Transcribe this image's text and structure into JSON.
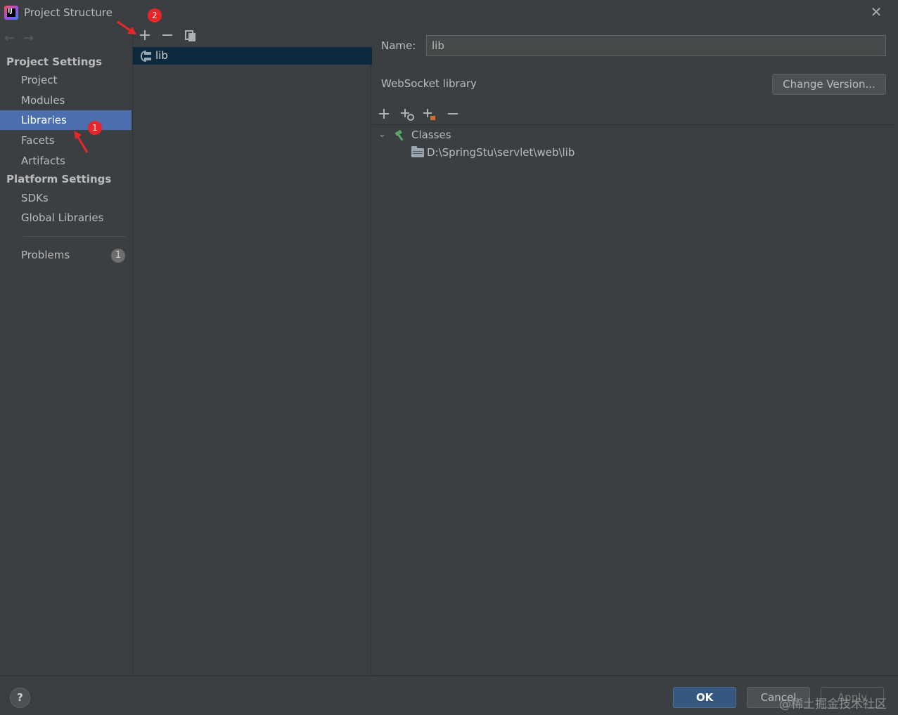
{
  "window": {
    "title": "Project Structure",
    "close_symbol": "✕"
  },
  "sidebar": {
    "nav_back": "←",
    "nav_forward": "→",
    "project_settings_header": "Project Settings",
    "project_settings_items": [
      {
        "label": "Project",
        "selected": false
      },
      {
        "label": "Modules",
        "selected": false
      },
      {
        "label": "Libraries",
        "selected": true
      },
      {
        "label": "Facets",
        "selected": false
      },
      {
        "label": "Artifacts",
        "selected": false
      }
    ],
    "platform_settings_header": "Platform Settings",
    "platform_settings_items": [
      {
        "label": "SDKs"
      },
      {
        "label": "Global Libraries"
      }
    ],
    "problems_label": "Problems",
    "problems_count": "1"
  },
  "libraries_panel": {
    "toolbar": {
      "add_icon": "plus-icon",
      "remove_icon": "minus-icon",
      "copy_icon": "copy-icon"
    },
    "items": [
      {
        "label": "lib",
        "selected": true
      }
    ]
  },
  "library_details": {
    "name_label": "Name:",
    "name_value": "lib",
    "library_type": "WebSocket library",
    "change_version_label": "Change Version...",
    "toolbar_icons": [
      "add-icon",
      "add-jar-icon",
      "add-source-icon",
      "remove-icon"
    ],
    "tree": {
      "root_label": "Classes",
      "children": [
        "D:\\SpringStu\\servlet\\web\\lib"
      ]
    }
  },
  "footer": {
    "help_label": "?",
    "ok_label": "OK",
    "cancel_label": "Cancel",
    "apply_label": "Apply",
    "watermark": "@稀土掘金技术社区"
  },
  "annotations": [
    {
      "number": "1"
    },
    {
      "number": "2"
    }
  ],
  "colors": {
    "background": "#3c3f41",
    "selection": "#4b6eaf",
    "list_selection": "#0d293e",
    "ok_button": "#365880",
    "annotation_red": "#e8262a"
  }
}
